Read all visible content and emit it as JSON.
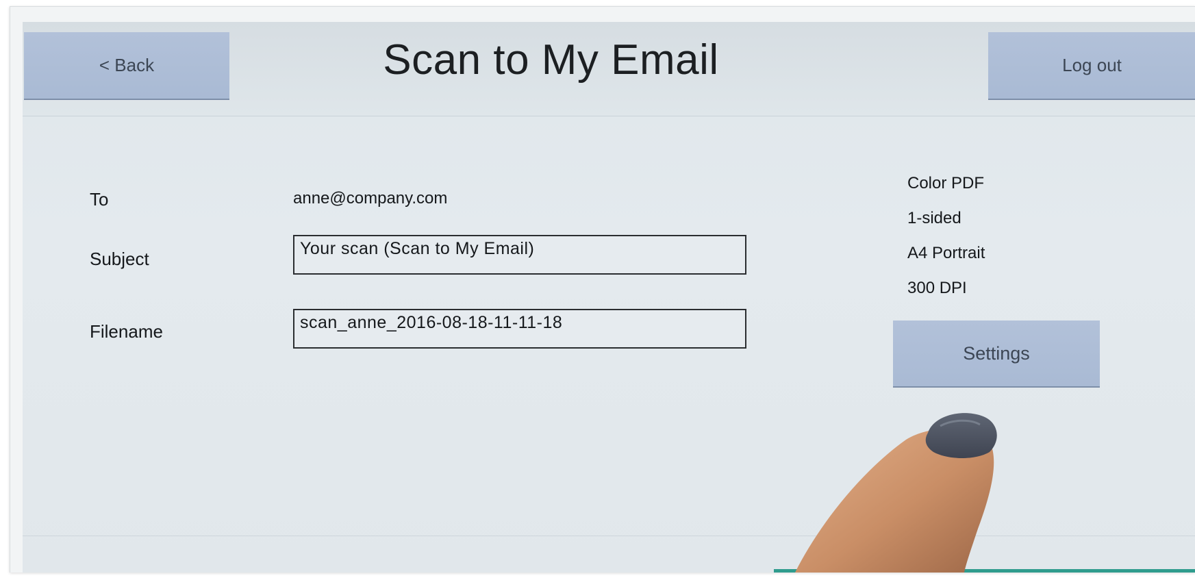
{
  "header": {
    "back_label": "< Back",
    "title": "Scan to My Email",
    "logout_label": "Log out"
  },
  "form": {
    "to_label": "To",
    "to_value": "anne@company.com",
    "subject_label": "Subject",
    "subject_value": "Your scan (Scan to My Email)",
    "filename_label": "Filename",
    "filename_value": "scan_anne_2016-08-18-11-11-18"
  },
  "scan_settings": {
    "format": "Color PDF",
    "sides": "1-sided",
    "paper": "A4 Portrait",
    "resolution": "300 DPI",
    "settings_label": "Settings"
  },
  "colors": {
    "button": "#aebdd6",
    "accent": "#2f9c8e"
  }
}
